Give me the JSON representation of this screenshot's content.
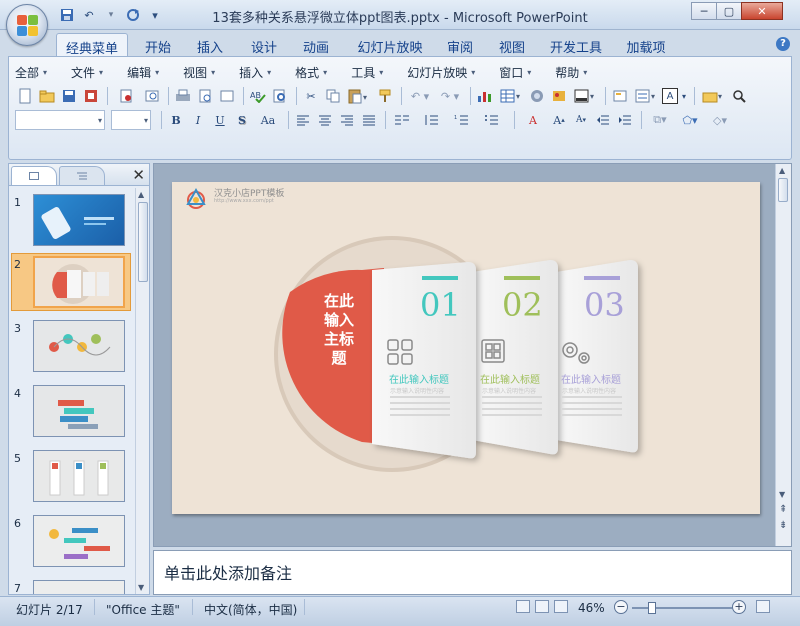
{
  "window": {
    "title": "13套多种关系悬浮微立体ppt图表.pptx - Microsoft PowerPoint",
    "controls": {
      "minimize": "─",
      "maximize": "▢",
      "close": "✕"
    }
  },
  "quick_access": {
    "save": "save-icon",
    "undo": "undo-icon",
    "redo": "redo-icon",
    "more": "▾"
  },
  "ribbon_tabs": [
    {
      "label": "经典菜单",
      "active": true
    },
    {
      "label": "开始"
    },
    {
      "label": "插入"
    },
    {
      "label": "设计"
    },
    {
      "label": "动画"
    },
    {
      "label": "幻灯片放映"
    },
    {
      "label": "审阅"
    },
    {
      "label": "视图"
    },
    {
      "label": "开发工具"
    },
    {
      "label": "加载项"
    }
  ],
  "help": "?",
  "classic_menu": [
    "全部",
    "文件",
    "编辑",
    "视图",
    "插入",
    "格式",
    "工具",
    "幻灯片放映",
    "窗口",
    "帮助"
  ],
  "formatting": {
    "bold": "B",
    "italic": "I",
    "underline": "U",
    "shadow": "S",
    "change_case": "Aa",
    "font_color": "A",
    "text_box": "A"
  },
  "thumbnail_pane": {
    "slides": [
      {
        "num": "1"
      },
      {
        "num": "2",
        "selected": true
      },
      {
        "num": "3"
      },
      {
        "num": "4"
      },
      {
        "num": "5"
      },
      {
        "num": "6"
      },
      {
        "num": "7"
      }
    ]
  },
  "slide": {
    "logo_text": "汉克小店PPT模板",
    "logo_sub": "http://www.xxx.com/ppt",
    "main_title": "在此输入主标题",
    "cards": [
      {
        "number": "01",
        "color": "#43c7be",
        "label": "在此输入标题",
        "icon": "grid-icon",
        "desc": "示意输入说明性内容"
      },
      {
        "number": "02",
        "color": "#9fbf5a",
        "label": "在此输入标题",
        "icon": "grid-icon",
        "desc": "示意输入说明性内容"
      },
      {
        "number": "03",
        "color": "#a8a0d8",
        "label": "在此输入标题",
        "icon": "gear-icon",
        "desc": "示意输入说明性内容"
      }
    ]
  },
  "notes": {
    "placeholder": "单击此处添加备注"
  },
  "status": {
    "slide_info": "幻灯片 2/17",
    "theme": "\"Office 主题\"",
    "language": "中文(简体，中国)",
    "zoom": "46%",
    "zoom_level": 0.46
  }
}
